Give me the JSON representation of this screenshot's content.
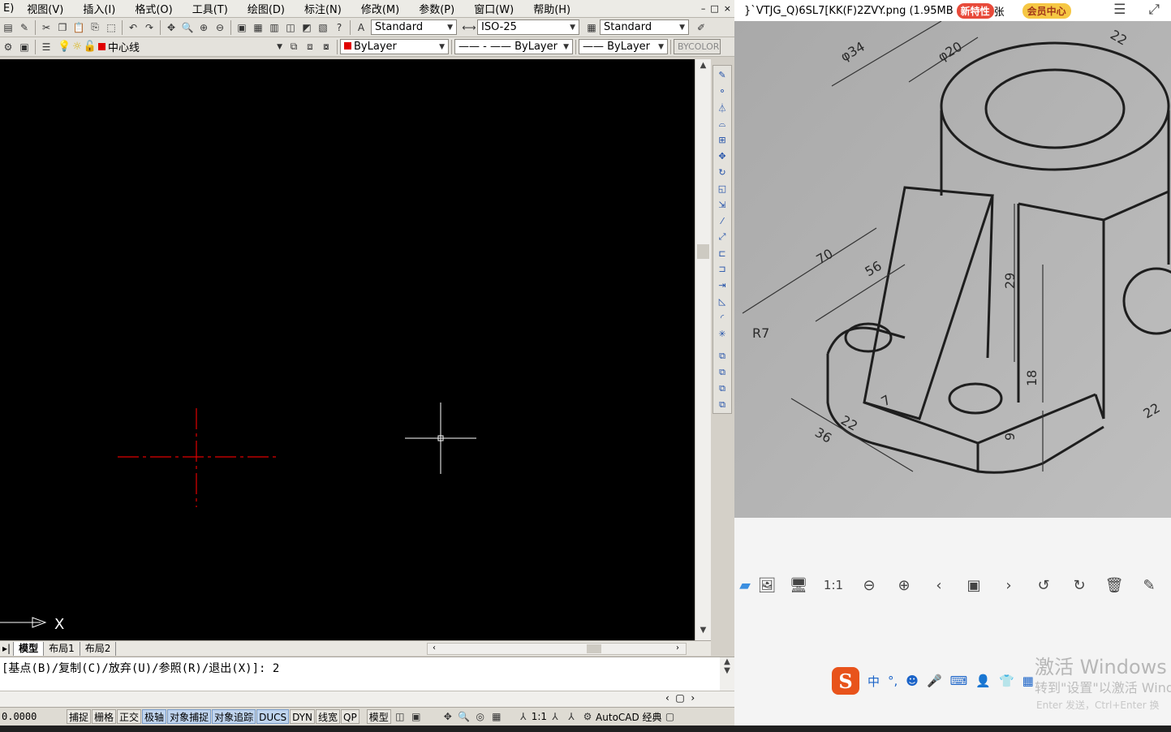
{
  "cad": {
    "menu": [
      "视图(V)",
      "插入(I)",
      "格式(O)",
      "工具(T)",
      "绘图(D)",
      "标注(N)",
      "修改(M)",
      "参数(P)",
      "窗口(W)",
      "帮助(H)"
    ],
    "menu_left_fragment": "E)",
    "window_controls": [
      "–",
      "□",
      "×"
    ],
    "toolbar1": {
      "text_style": "Standard",
      "dim_style": "ISO-25",
      "table_style": "Standard"
    },
    "toolbar2": {
      "layer": "中心线",
      "color": "ByLayer",
      "linetype": "ByLayer",
      "lineweight": "ByLayer",
      "plotstyle": "BYCOLOR"
    },
    "ucs_label": "X",
    "tabs": [
      "模型",
      "布局1",
      "布局2"
    ],
    "command_line": "[基点(B)/复制(C)/放弃(U)/参照(R)/退出(X)]: 2",
    "coordinates": "0.0000",
    "status_buttons": [
      {
        "label": "捕捉",
        "on": false
      },
      {
        "label": "栅格",
        "on": false
      },
      {
        "label": "正交",
        "on": false
      },
      {
        "label": "极轴",
        "on": true
      },
      {
        "label": "对象捕捉",
        "on": true
      },
      {
        "label": "对象追踪",
        "on": true
      },
      {
        "label": "DUCS",
        "on": true
      },
      {
        "label": "DYN",
        "on": false
      },
      {
        "label": "线宽",
        "on": false
      },
      {
        "label": "QP",
        "on": false
      }
    ],
    "status_right": {
      "model": "模型",
      "scale": "1:1",
      "workspace": "AutoCAD 经典"
    },
    "colors": {
      "canvas": "#000000",
      "centerline": "#e00000",
      "crosshair": "#ffffff"
    }
  },
  "viewer": {
    "filename": "}`VTJG_Q)6SL7[KK(F)2ZVY.png (1.95MB",
    "badge_new": "新特性",
    "badge_suffix": "张",
    "vip": "会员中心",
    "drawing_dims": [
      "φ34",
      "φ20",
      "22",
      "70",
      "56",
      "29",
      "R7",
      "7",
      "18",
      "36",
      "22",
      "9",
      "22"
    ],
    "toolbar_icons": [
      "folder-icon",
      "image-icon",
      "monitor-icon",
      "actual-size-icon",
      "zoom-out-icon",
      "zoom-in-icon",
      "prev-icon",
      "slideshow-icon",
      "next-icon",
      "rotate-left-icon",
      "rotate-right-icon",
      "delete-icon",
      "edit-icon"
    ],
    "actual_size_label": "1:1",
    "watermark_title": "激活 Windows",
    "watermark_sub": "转到\"设置\"以激活 Wind",
    "ime_hint": "Enter 发送，Ctrl+Enter 换",
    "ime_mode": "中"
  }
}
